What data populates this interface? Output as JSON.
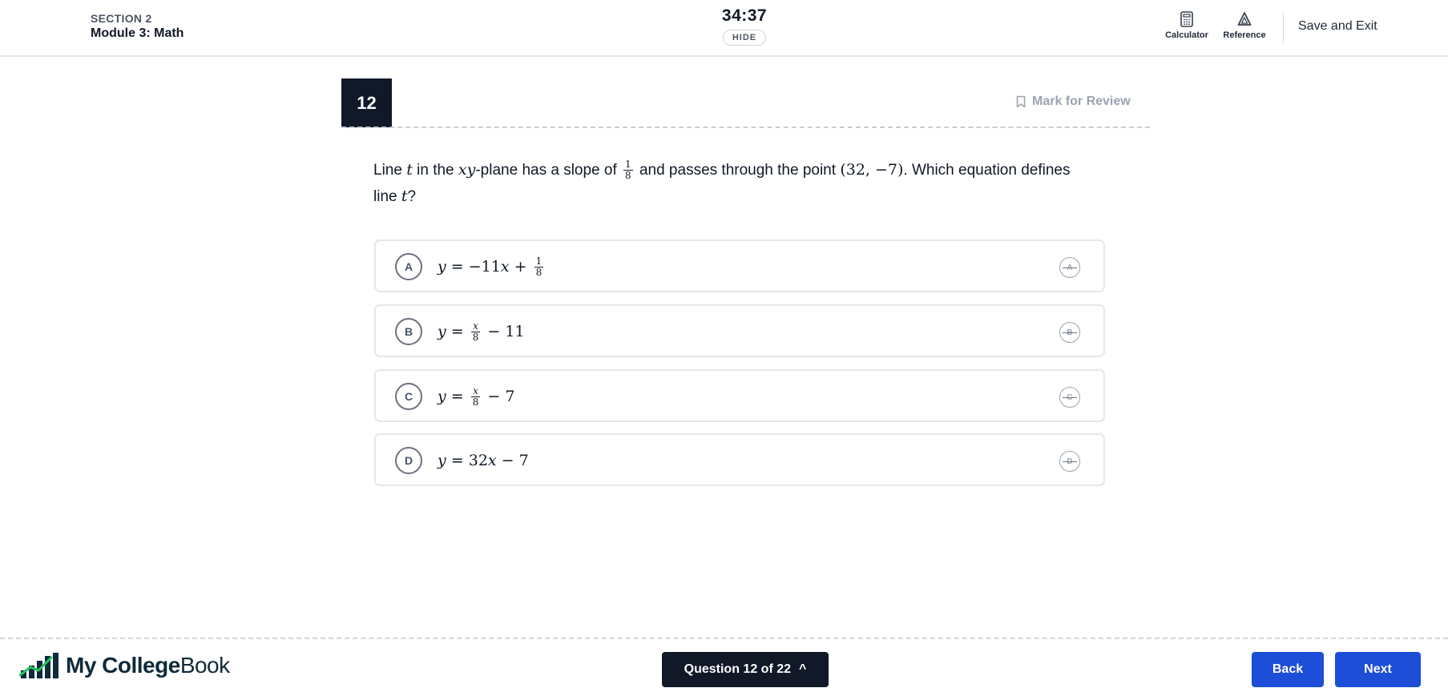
{
  "header": {
    "section": "SECTION 2",
    "module": "Module 3: Math",
    "timer": "34:37",
    "hide_label": "HIDE",
    "calculator_label": "Calculator",
    "reference_label": "Reference",
    "save_exit_label": "Save and Exit"
  },
  "question": {
    "number": "12",
    "mark_review_label": "Mark for Review",
    "text_parts": {
      "p1": "Line ",
      "var_t": "t",
      "p2": " in the ",
      "var_xy": "xy",
      "p3": "-plane has a slope of ",
      "slope_num": "1",
      "slope_den": "8",
      "p4": " and passes through the point ",
      "point": "(32, −7)",
      "p5": ". Which equation defines line ",
      "var_t2": "t",
      "p6": "?"
    }
  },
  "choices": [
    {
      "letter": "A",
      "lhs": "y",
      "eq": " = −11",
      "x": "x",
      "rest": " + ",
      "frac_num": "1",
      "frac_den": "8",
      "tail": ""
    },
    {
      "letter": "B",
      "lhs": "y",
      "eq": " = ",
      "frac_num": "x",
      "frac_den": "8",
      "tail": " − 11"
    },
    {
      "letter": "C",
      "lhs": "y",
      "eq": " = ",
      "frac_num": "x",
      "frac_den": "8",
      "tail": " − 7"
    },
    {
      "letter": "D",
      "lhs": "y",
      "eq": " = 32",
      "x": "x",
      "tail": " − 7"
    }
  ],
  "footer": {
    "logo_bold": "My College",
    "logo_light": "Book",
    "question_nav_label": "Question 12 of 22",
    "question_nav_caret": "^",
    "back_label": "Back",
    "next_label": "Next"
  },
  "colors": {
    "primary_blue": "#1d4ed8",
    "dark": "#111827",
    "logo_green": "#22c55e"
  }
}
